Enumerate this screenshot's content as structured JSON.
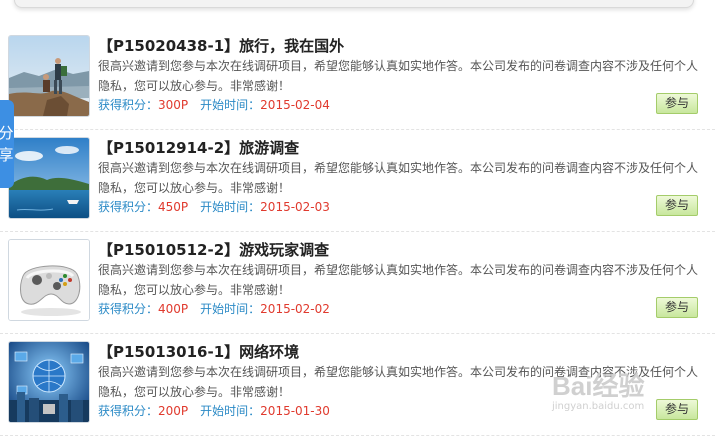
{
  "share_label": "分享",
  "colors": {
    "title_text": "#222222",
    "meta_label": "#2b8ac6",
    "meta_value": "#e03a2e",
    "button_green": "#c8e79d",
    "share_blue": "#3d8fe3"
  },
  "surveys": [
    {
      "title": "【P15020438-1】旅行，我在国外",
      "description": "很高兴邀请到您参与本次在线调研项目，希望您能够认真如实地作答。本公司发布的问卷调查内容不涉及任何个人隐私，您可以放心参与。非常感谢！",
      "points_label": "获得积分：",
      "points_value": "300P",
      "start_label": "开始时间：",
      "start_value": "2015-02-04",
      "button_label": "参与",
      "image": "hikers-on-cliff"
    },
    {
      "title": "【P15012914-2】旅游调查",
      "description": "很高兴邀请到您参与本次在线调研项目，希望您能够认真如实地作答。本公司发布的问卷调查内容不涉及任何个人隐私，您可以放心参与。非常感谢！",
      "points_label": "获得积分：",
      "points_value": "450P",
      "start_label": "开始时间：",
      "start_value": "2015-02-03",
      "button_label": "参与",
      "image": "island-sea"
    },
    {
      "title": "【P15010512-2】游戏玩家调查",
      "description": "很高兴邀请到您参与本次在线调研项目，希望您能够认真如实地作答。本公司发布的问卷调查内容不涉及任何个人隐私，您可以放心参与。非常感谢！",
      "points_label": "获得积分：",
      "points_value": "400P",
      "start_label": "开始时间：",
      "start_value": "2015-02-02",
      "button_label": "参与",
      "image": "game-controller"
    },
    {
      "title": "【P15013016-1】网络环境",
      "description": "很高兴邀请到您参与本次在线调研项目，希望您能够认真如实地作答。本公司发布的问卷调查内容不涉及任何个人隐私，您可以放心参与。非常感谢！",
      "points_label": "获得积分：",
      "points_value": "200P",
      "start_label": "开始时间：",
      "start_value": "2015-01-30",
      "button_label": "参与",
      "image": "network-globe"
    }
  ],
  "watermark": {
    "main": "Bai经验",
    "sub": "jingyan.baidu.com"
  }
}
